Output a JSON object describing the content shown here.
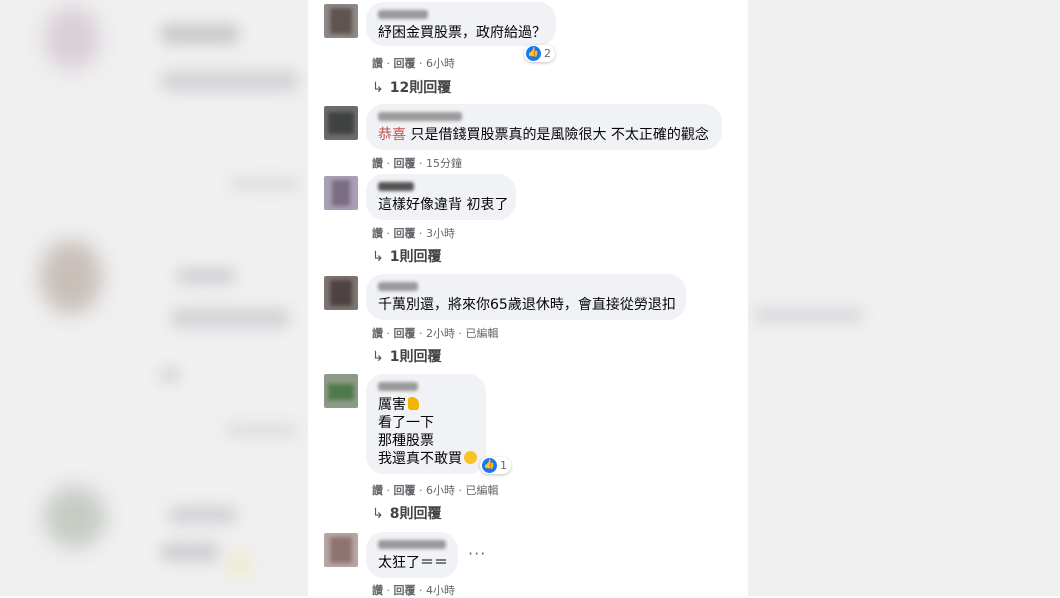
{
  "comments": [
    {
      "text": "紓困金買股票，政府給過？",
      "actions": {
        "like": "讚",
        "reply": "回覆",
        "time": "6小時"
      },
      "reaction_count": "2",
      "replies": "12則回覆"
    },
    {
      "mention": "恭喜",
      "text": " 只是借錢買股票真的是風險很大 不太正確的觀念",
      "actions": {
        "like": "讚",
        "reply": "回覆",
        "time": "15分鐘"
      }
    },
    {
      "text": "這樣好像違背 初衷了",
      "actions": {
        "like": "讚",
        "reply": "回覆",
        "time": "3小時"
      },
      "replies": "1則回覆"
    },
    {
      "text": "千萬別還，將來你65歲退休時，會直接從勞退扣",
      "actions": {
        "like": "讚",
        "reply": "回覆",
        "time": "2小時",
        "edited": "已編輯"
      },
      "replies": "1則回覆"
    },
    {
      "lines": [
        "厲害",
        "看了一下",
        "那種股票",
        "我還真不敢買"
      ],
      "actions": {
        "like": "讚",
        "reply": "回覆",
        "time": "6小時",
        "edited": "已編輯"
      },
      "reaction_count": "1",
      "replies": "8則回覆"
    },
    {
      "text": "太狂了＝＝",
      "actions": {
        "like": "讚",
        "reply": "回覆",
        "time": "4小時"
      },
      "more": "···"
    }
  ],
  "separator": " · ",
  "reply_arrow": "↳",
  "icons": {
    "like": "like-icon",
    "thumb": "thumbs-up-emoji",
    "smile": "smile-emoji",
    "more": "more-options-icon"
  },
  "colors": {
    "bubble": "#f0f2f5",
    "mention": "#c0504d",
    "like_blue": "#1877f2",
    "meta": "#65676b"
  }
}
